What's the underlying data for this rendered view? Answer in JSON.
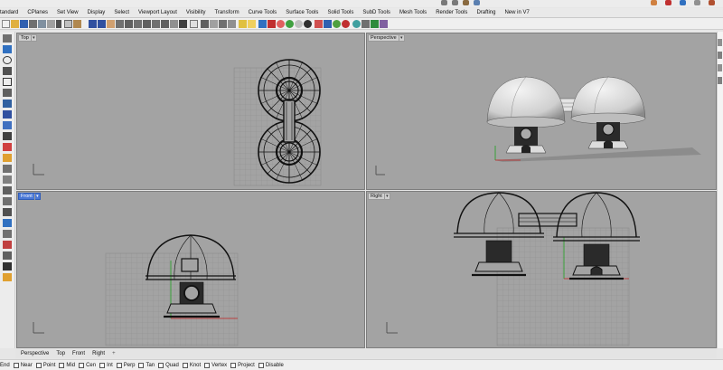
{
  "menu_tabs": [
    "tandard",
    "CPlanes",
    "Set View",
    "Display",
    "Select",
    "Viewport Layout",
    "Visibility",
    "Transform",
    "Curve Tools",
    "Surface Tools",
    "Solid Tools",
    "SubD Tools",
    "Mesh Tools",
    "Render Tools",
    "Drafting",
    "New in V7"
  ],
  "viewports": {
    "top": {
      "title": "Top"
    },
    "perspective": {
      "title": "Perspective"
    },
    "front": {
      "title": "Front"
    },
    "right": {
      "title": "Right"
    }
  },
  "viewport_tabs": [
    "Perspective",
    "Top",
    "Front",
    "Right"
  ],
  "add_viewport_symbol": "+",
  "osnaps": [
    "End",
    "Near",
    "Point",
    "Mid",
    "Cen",
    "Int",
    "Perp",
    "Tan",
    "Quad",
    "Knot",
    "Vertex",
    "Project",
    "Disable"
  ],
  "colors": {
    "viewport_bg": "#a3a3a3",
    "active_title": "#4a78d6",
    "x_axis": "#c02020",
    "y_axis": "#20a020"
  }
}
